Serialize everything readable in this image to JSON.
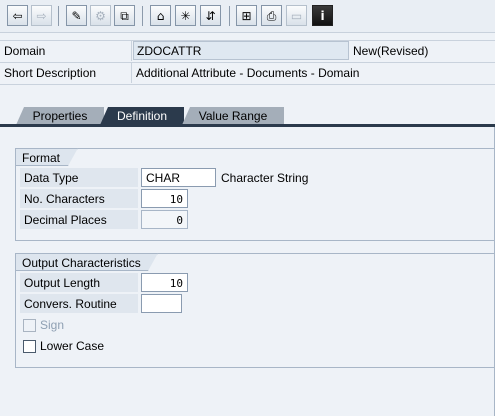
{
  "toolbar": {
    "buttons": [
      {
        "icon": "back-arrow-icon",
        "glyph": "⇦"
      },
      {
        "icon": "forward-arrow-icon",
        "glyph": "⇨"
      },
      {
        "icon": "display-change-icon",
        "glyph": "✎"
      },
      {
        "icon": "other-object-icon",
        "glyph": "⚙"
      },
      {
        "icon": "activate-icon",
        "glyph": "⧉"
      },
      {
        "icon": "where-used-icon",
        "glyph": "⌂"
      },
      {
        "icon": "object-list-icon",
        "glyph": "✳"
      },
      {
        "icon": "navigation-window-icon",
        "glyph": "⇵"
      },
      {
        "icon": "hierarchy-icon",
        "glyph": "⊞"
      },
      {
        "icon": "print-icon",
        "glyph": "⎙"
      },
      {
        "icon": "layout-icon",
        "glyph": "▭"
      },
      {
        "icon": "info-icon",
        "glyph": "i"
      }
    ]
  },
  "header": {
    "domain_label": "Domain",
    "domain_value": "ZDOCATTR",
    "status": "New(Revised)",
    "short_desc_label": "Short Description",
    "short_desc_value": "Additional Attribute - Documents - Domain"
  },
  "tabs": [
    {
      "label": "Properties",
      "active": false
    },
    {
      "label": "Definition",
      "active": true
    },
    {
      "label": "Value Range",
      "active": false
    }
  ],
  "format": {
    "title": "Format",
    "data_type_label": "Data Type",
    "data_type_value": "CHAR",
    "data_type_desc": "Character String",
    "num_chars_label": "No. Characters",
    "num_chars_value": "10",
    "decimal_places_label": "Decimal Places",
    "decimal_places_value": "0"
  },
  "output": {
    "title": "Output Characteristics",
    "output_length_label": "Output Length",
    "output_length_value": "10",
    "convers_routine_label": "Convers. Routine",
    "convers_routine_value": "",
    "sign_label": "Sign",
    "sign_checked": false,
    "lower_case_label": "Lower Case",
    "lower_case_checked": false
  }
}
